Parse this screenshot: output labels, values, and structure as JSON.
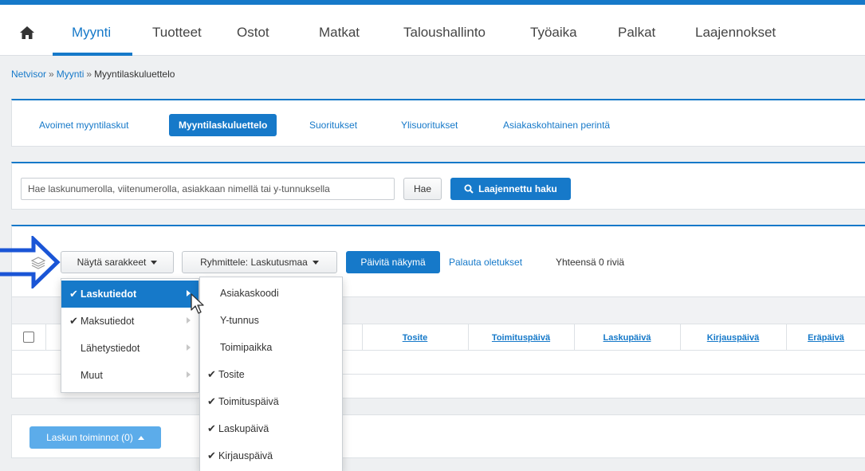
{
  "mainnav": {
    "home_icon": "home-icon",
    "items": [
      {
        "label": "Myynti",
        "active": true
      },
      {
        "label": "Tuotteet"
      },
      {
        "label": "Ostot"
      },
      {
        "label": "Matkat"
      },
      {
        "label": "Taloushallinto"
      },
      {
        "label": "Työaika"
      },
      {
        "label": "Palkat"
      },
      {
        "label": "Laajennokset"
      }
    ]
  },
  "breadcrumb": {
    "items": [
      "Netvisor",
      "Myynti"
    ],
    "current": "Myyntilaskuluettelo",
    "separator": "»"
  },
  "subtabs": [
    {
      "label": "Avoimet myyntilaskut"
    },
    {
      "label": "Myyntilaskuluettelo",
      "active": true
    },
    {
      "label": "Suoritukset"
    },
    {
      "label": "Ylisuoritukset"
    },
    {
      "label": "Asiakaskohtainen perintä"
    }
  ],
  "search": {
    "placeholder": "Hae laskunumerolla, viitenumerolla, asiakkaan nimellä tai y-tunnuksella",
    "value": "",
    "search_button": "Hae",
    "advanced_button": "Laajennettu haku"
  },
  "toolbar": {
    "columns_button": "Näytä sarakkeet",
    "group_button": "Ryhmittele: Laskutusmaa",
    "refresh_button": "Päivitä näkymä",
    "reset_link": "Palauta oletukset",
    "row_count": "Yhteensä 0 riviä"
  },
  "table": {
    "columns": [
      "Tosite",
      "Toimituspäivä",
      "Laskupäivä",
      "Kirjauspäivä",
      "Eräpäivä"
    ]
  },
  "actions": {
    "invoice_actions_button": "Laskun toiminnot (0)"
  },
  "column_menu": {
    "categories": [
      {
        "label": "Laskutiedot",
        "checked": true,
        "active": true
      },
      {
        "label": "Maksutiedot",
        "checked": true
      },
      {
        "label": "Lähetystiedot",
        "checked": false
      },
      {
        "label": "Muut",
        "checked": false
      }
    ],
    "submenu": [
      {
        "label": "Asiakaskoodi",
        "checked": false
      },
      {
        "label": "Y-tunnus",
        "checked": false
      },
      {
        "label": "Toimipaikka",
        "checked": false
      },
      {
        "label": "Tosite",
        "checked": true
      },
      {
        "label": "Toimituspäivä",
        "checked": true
      },
      {
        "label": "Laskupäivä",
        "checked": true
      },
      {
        "label": "Kirjauspäivä",
        "checked": true
      }
    ],
    "check_glyph": "✔"
  },
  "colors": {
    "accent": "#1679c9",
    "arrow_annotation": "#1a55d6"
  }
}
